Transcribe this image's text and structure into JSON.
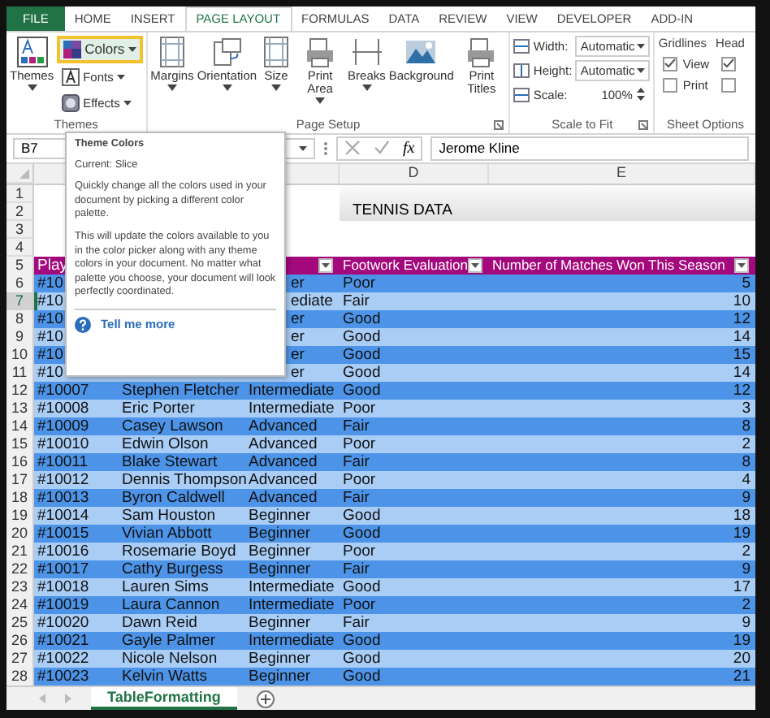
{
  "ribbon_tabs": [
    {
      "label": "FILE",
      "kind": "file",
      "selected": false
    },
    {
      "label": "HOME",
      "kind": "tab",
      "selected": false
    },
    {
      "label": "INSERT",
      "kind": "tab",
      "selected": false
    },
    {
      "label": "PAGE LAYOUT",
      "kind": "tab",
      "selected": true
    },
    {
      "label": "FORMULAS",
      "kind": "tab",
      "selected": false
    },
    {
      "label": "DATA",
      "kind": "tab",
      "selected": false
    },
    {
      "label": "REVIEW",
      "kind": "tab",
      "selected": false
    },
    {
      "label": "VIEW",
      "kind": "tab",
      "selected": false
    },
    {
      "label": "DEVELOPER",
      "kind": "tab",
      "selected": false
    },
    {
      "label": "ADD-IN",
      "kind": "tab",
      "selected": false
    }
  ],
  "themes_group": {
    "label": "Themes",
    "themes_button": {
      "label": "Themes"
    },
    "menus": [
      {
        "label": "Colors",
        "highlighted": true
      },
      {
        "label": "Fonts",
        "highlighted": false
      },
      {
        "label": "Effects",
        "highlighted": false
      }
    ]
  },
  "page_setup_group": {
    "label": "Page Setup",
    "launcher": true,
    "buttons": [
      {
        "label": "Margins",
        "dropdown": true
      },
      {
        "label": "Orientation",
        "dropdown": true
      },
      {
        "label": "Size",
        "dropdown": true
      },
      {
        "label": "Print Area",
        "dropdown": true
      },
      {
        "label": "Breaks",
        "dropdown": true
      },
      {
        "label": "Background",
        "dropdown": false
      },
      {
        "label": "Print Titles",
        "dropdown": false
      }
    ]
  },
  "scale_group": {
    "label": "Scale to Fit",
    "launcher": true,
    "fields": [
      {
        "label": "Width:",
        "value": "Automatic",
        "kind": "dropdown"
      },
      {
        "label": "Height:",
        "value": "Automatic",
        "kind": "dropdown"
      },
      {
        "label": "Scale:",
        "value": "100%",
        "kind": "spinner"
      }
    ]
  },
  "sheet_options_group": {
    "label": "Sheet Options",
    "columns": [
      {
        "heading": "Gridlines",
        "options": [
          {
            "label": "View",
            "checked": true
          },
          {
            "label": "Print",
            "checked": false
          }
        ]
      },
      {
        "heading": "Head",
        "options": [
          {
            "checked": true
          },
          {
            "checked": false
          }
        ]
      }
    ]
  },
  "formula_bar": {
    "name_box": "B7",
    "fx": "fx",
    "formula": "Jerome Kline"
  },
  "column_headers": [
    "D",
    "E"
  ],
  "top_rows": [
    "1",
    "2",
    "3",
    "4"
  ],
  "sheet_title": "TENNIS DATA",
  "header_row": {
    "row": "5",
    "col_a": "Play",
    "col_d": "Footwork Evaluation",
    "col_e": "Number of Matches Won This Season"
  },
  "rows": [
    {
      "row": "6",
      "id": "#10",
      "level": "er",
      "footwork": "Poor",
      "wins": "5",
      "selected": false
    },
    {
      "row": "7",
      "id": "#10",
      "level": "ediate",
      "footwork": "Fair",
      "wins": "10",
      "selected": true
    },
    {
      "row": "8",
      "id": "#10",
      "level": "er",
      "footwork": "Good",
      "wins": "12",
      "selected": false
    },
    {
      "row": "9",
      "id": "#10",
      "level": "er",
      "footwork": "Good",
      "wins": "14",
      "selected": false
    },
    {
      "row": "10",
      "id": "#10",
      "level": "er",
      "footwork": "Good",
      "wins": "15",
      "selected": false
    },
    {
      "row": "11",
      "id": "#10",
      "level": "er",
      "footwork": "Good",
      "wins": "14",
      "selected": false
    },
    {
      "row": "12",
      "id": "#10007",
      "player": "Stephen Fletcher",
      "level": "Intermediate",
      "footwork": "Good",
      "wins": "12",
      "selected": false
    },
    {
      "row": "13",
      "id": "#10008",
      "player": "Eric Porter",
      "level": "Intermediate",
      "footwork": "Poor",
      "wins": "3",
      "selected": false
    },
    {
      "row": "14",
      "id": "#10009",
      "player": "Casey Lawson",
      "level": "Advanced",
      "footwork": "Fair",
      "wins": "8",
      "selected": false
    },
    {
      "row": "15",
      "id": "#10010",
      "player": "Edwin Olson",
      "level": "Advanced",
      "footwork": "Poor",
      "wins": "2",
      "selected": false
    },
    {
      "row": "16",
      "id": "#10011",
      "player": "Blake Stewart",
      "level": "Advanced",
      "footwork": "Fair",
      "wins": "8",
      "selected": false
    },
    {
      "row": "17",
      "id": "#10012",
      "player": "Dennis Thompson",
      "level": "Advanced",
      "footwork": "Poor",
      "wins": "4",
      "selected": false
    },
    {
      "row": "18",
      "id": "#10013",
      "player": "Byron Caldwell",
      "level": "Advanced",
      "footwork": "Fair",
      "wins": "9",
      "selected": false
    },
    {
      "row": "19",
      "id": "#10014",
      "player": "Sam Houston",
      "level": "Beginner",
      "footwork": "Good",
      "wins": "18",
      "selected": false
    },
    {
      "row": "20",
      "id": "#10015",
      "player": "Vivian Abbott",
      "level": "Beginner",
      "footwork": "Good",
      "wins": "19",
      "selected": false
    },
    {
      "row": "21",
      "id": "#10016",
      "player": "Rosemarie Boyd",
      "level": "Beginner",
      "footwork": "Poor",
      "wins": "2",
      "selected": false
    },
    {
      "row": "22",
      "id": "#10017",
      "player": "Cathy Burgess",
      "level": "Beginner",
      "footwork": "Fair",
      "wins": "9",
      "selected": false
    },
    {
      "row": "23",
      "id": "#10018",
      "player": "Lauren Sims",
      "level": "Intermediate",
      "footwork": "Good",
      "wins": "17",
      "selected": false
    },
    {
      "row": "24",
      "id": "#10019",
      "player": "Laura Cannon",
      "level": "Intermediate",
      "footwork": "Poor",
      "wins": "2",
      "selected": false
    },
    {
      "row": "25",
      "id": "#10020",
      "player": "Dawn Reid",
      "level": "Beginner",
      "footwork": "Fair",
      "wins": "9",
      "selected": false
    },
    {
      "row": "26",
      "id": "#10021",
      "player": "Gayle Palmer",
      "level": "Intermediate",
      "footwork": "Good",
      "wins": "19",
      "selected": false
    },
    {
      "row": "27",
      "id": "#10022",
      "player": "Nicole Nelson",
      "level": "Beginner",
      "footwork": "Good",
      "wins": "20",
      "selected": false
    },
    {
      "row": "28",
      "id": "#10023",
      "player": "Kelvin Watts",
      "level": "Beginner",
      "footwork": "Good",
      "wins": "21",
      "selected": false
    }
  ],
  "sheet_tabs": [
    {
      "label": "TableFormatting",
      "selected": true
    }
  ],
  "tooltip": {
    "title": "Theme Colors",
    "current": "Current: Slice",
    "paragraphs": [
      "Quickly change all the colors used in your document by picking a different color palette.",
      "This will update the colors available to you in the color picker along with any theme colors in your document. No matter what palette you choose, your document will look perfectly coordinated."
    ],
    "link": "Tell me more"
  }
}
